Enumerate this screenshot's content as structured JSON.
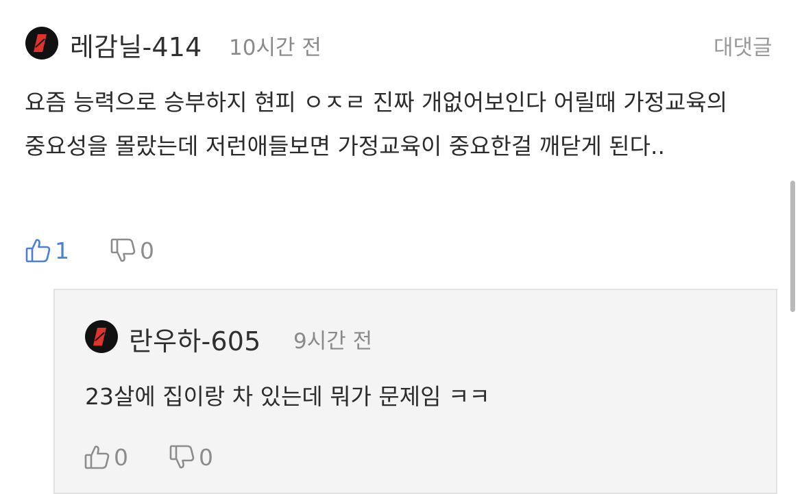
{
  "comment": {
    "username": "레감닐-414",
    "time": "10시간 전",
    "reply_label": "대댓글",
    "text": "요즘 능력으로 승부하지 현피 ㅇㅈㄹ 진짜 개없어보인다 어릴때 가정교육의 중요성을 몰랐는데 저런애들보면 가정교육이 중요한걸 깨닫게 된다..",
    "likes": "1",
    "dislikes": "0"
  },
  "reply": {
    "username": "란우하-605",
    "time": "9시간 전",
    "text": "23살에 집이랑 차 있는데 뭐가 문제임 ㅋㅋ",
    "likes": "0",
    "dislikes": "0"
  },
  "icons": {
    "avatar": "avatar-logo-icon",
    "like": "thumbs-up-icon",
    "dislike": "thumbs-down-icon"
  },
  "colors": {
    "like_active": "#4a7fd9",
    "muted": "#8c8c8c",
    "avatar_bg": "#111111",
    "avatar_mark": "#e0332b",
    "reply_bg": "#f4f4f4"
  }
}
